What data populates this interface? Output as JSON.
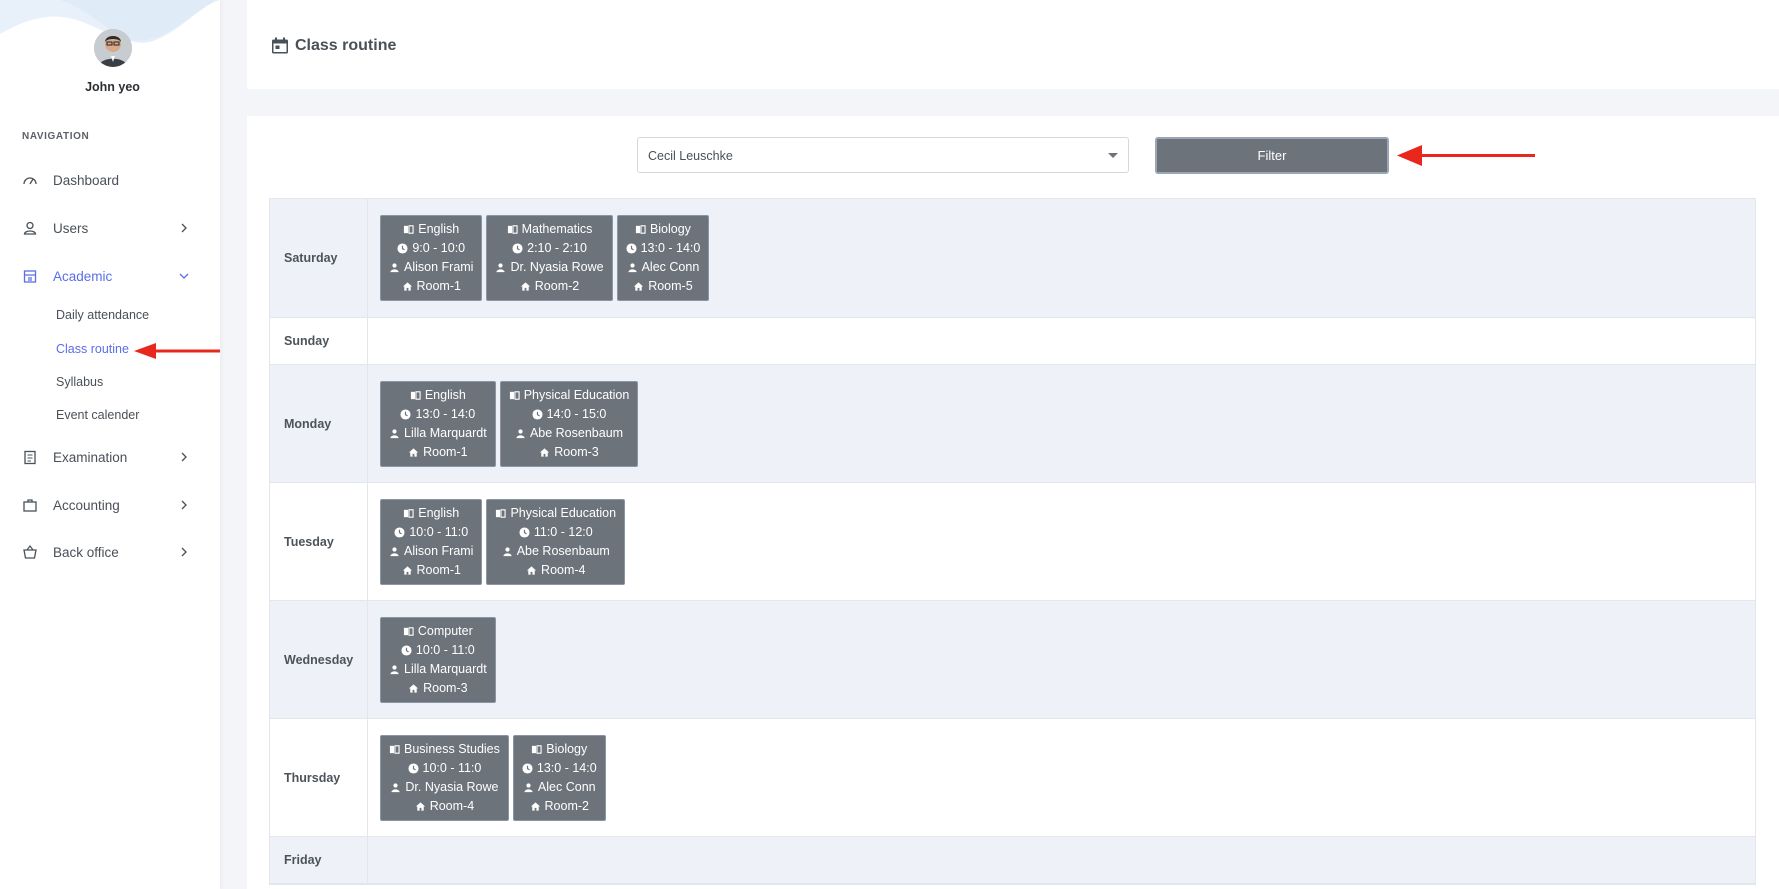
{
  "sidebar": {
    "profile_name": "John yeo",
    "nav_header": "NAVIGATION",
    "items": [
      {
        "label": "Dashboard"
      },
      {
        "label": "Users"
      },
      {
        "label": "Academic"
      },
      {
        "label": "Examination"
      },
      {
        "label": "Accounting"
      },
      {
        "label": "Back office"
      }
    ],
    "academic_sub": [
      {
        "label": "Daily attendance"
      },
      {
        "label": "Class routine"
      },
      {
        "label": "Syllabus"
      },
      {
        "label": "Event calender"
      }
    ]
  },
  "header": {
    "title": "Class routine"
  },
  "filter": {
    "selected_teacher": "Cecil Leuschke",
    "button_label": "Filter"
  },
  "routine": {
    "days": [
      {
        "day": "Saturday",
        "periods": [
          {
            "subject": "English",
            "time": "9:0 - 10:0",
            "teacher": "Alison Frami",
            "room": "Room-1"
          },
          {
            "subject": "Mathematics",
            "time": "2:10 - 2:10",
            "teacher": "Dr. Nyasia Rowe",
            "room": "Room-2"
          },
          {
            "subject": "Biology",
            "time": "13:0 - 14:0",
            "teacher": "Alec Conn",
            "room": "Room-5"
          }
        ]
      },
      {
        "day": "Sunday",
        "periods": []
      },
      {
        "day": "Monday",
        "periods": [
          {
            "subject": "English",
            "time": "13:0 - 14:0",
            "teacher": "Lilla Marquardt",
            "room": "Room-1"
          },
          {
            "subject": "Physical Education",
            "time": "14:0 - 15:0",
            "teacher": "Abe Rosenbaum",
            "room": "Room-3"
          }
        ]
      },
      {
        "day": "Tuesday",
        "periods": [
          {
            "subject": "English",
            "time": "10:0 - 11:0",
            "teacher": "Alison Frami",
            "room": "Room-1"
          },
          {
            "subject": "Physical Education",
            "time": "11:0 - 12:0",
            "teacher": "Abe Rosenbaum",
            "room": "Room-4"
          }
        ]
      },
      {
        "day": "Wednesday",
        "periods": [
          {
            "subject": "Computer",
            "time": "10:0 - 11:0",
            "teacher": "Lilla Marquardt",
            "room": "Room-3"
          }
        ]
      },
      {
        "day": "Thursday",
        "periods": [
          {
            "subject": "Business Studies",
            "time": "10:0 - 11:0",
            "teacher": "Dr. Nyasia Rowe",
            "room": "Room-4"
          },
          {
            "subject": "Biology",
            "time": "13:0 - 14:0",
            "teacher": "Alec Conn",
            "room": "Room-2"
          }
        ]
      },
      {
        "day": "Friday",
        "periods": []
      }
    ]
  },
  "colors": {
    "accent": "#5a6ee8",
    "arrow": "#e8281c",
    "period_bg": "#6c737b",
    "row_shade": "#eef1f8"
  },
  "icons": {
    "subject": "book-icon",
    "time": "clock-icon",
    "teacher": "person-icon",
    "room": "home-icon"
  }
}
